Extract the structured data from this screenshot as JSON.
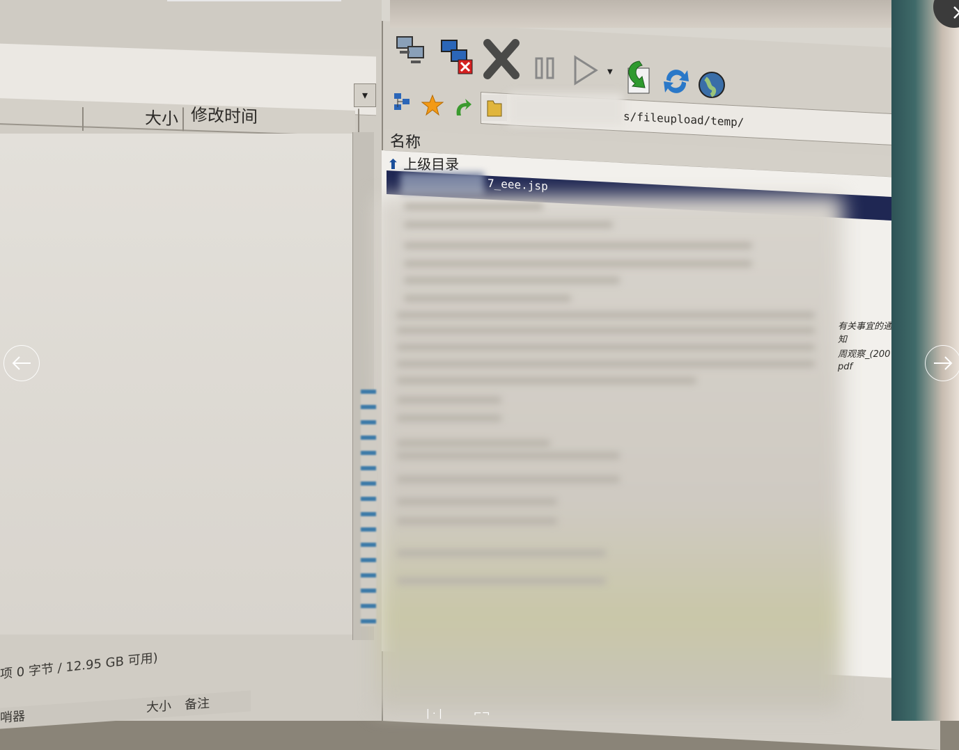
{
  "viewer": {
    "prev_icon": "arrow-left-icon",
    "next_icon": "arrow-right-icon",
    "close_icon": "close-icon"
  },
  "left_panel": {
    "columns": [
      "大小",
      "修改时间"
    ],
    "status_bytes": "项 0 字节 / 12.95 GB 可用)",
    "status_label": "哨器",
    "bottom_columns": [
      "大小",
      "备注"
    ]
  },
  "right_panel": {
    "toolbar_icons": [
      "connect-icon",
      "disconnect-icon",
      "stop-icon",
      "pause-icon",
      "play-icon",
      "download-icon",
      "refresh-icon",
      "globe-icon"
    ],
    "nav_icons": [
      "tree-icon",
      "favorite-star-icon",
      "back-arrow-icon",
      "folder-icon"
    ],
    "path_suffix": "s/fileupload/temp/",
    "column_name": "名称",
    "parent_dir": "上级目录",
    "selected_file": "7_eee.jsp",
    "side_texts": [
      "有关事宜的通知",
      "周观察_(200",
      "pdf"
    ]
  },
  "bottom_icons": [
    "pause-icon",
    "crop-icon"
  ]
}
